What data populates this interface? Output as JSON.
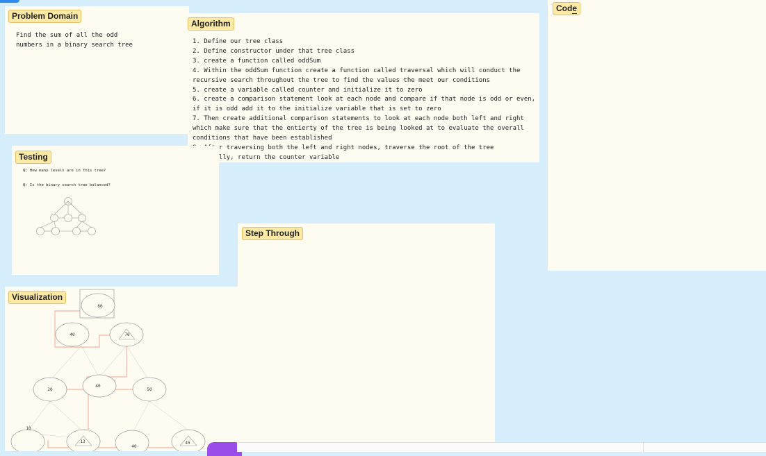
{
  "panels": {
    "problem_domain": {
      "title": "Problem Domain",
      "text": "Find the sum of all the odd\nnumbers in a binary search tree"
    },
    "algorithm": {
      "title": "Algorithm",
      "steps": [
        "1. Define our tree class",
        "2.  Define constructor under that tree class",
        "3. create a function called oddSum",
        "4. Within the oddSum function create a function called traversal which will conduct the recursive search throughout the tree to find the values the meet our conditions",
        "5. create a variable called counter and initialize it to zero",
        "6. create a comparison statement look at each node and compare if that node is odd or even, if it is odd add it to the initialize variable that is set to zero",
        "7. Then create additional comparison statements to look at each node both left and right which make sure that the entierty of the tree is being looked at to evaluate the overall conditions that have been established",
        "8. After traversing both the left and right nodes, traverse the root of the tree",
        "9. Finally, return the counter variable"
      ]
    },
    "code": {
      "title": "Code"
    },
    "testing": {
      "title": "Testing",
      "questions": [
        "Q: How many levels are in this tree?",
        "Q: Is the binary search tree balanced?"
      ]
    },
    "step_through": {
      "title": "Step Through"
    },
    "visualization": {
      "title": "Visualization",
      "nodes": [
        "60",
        "40",
        "70",
        "20",
        "40",
        "50",
        "10",
        "13",
        "40",
        "45"
      ]
    }
  },
  "colors": {
    "canvas": "#d6eefc",
    "panel": "#fefcf0",
    "label_bg": "#fde9a6",
    "highlight_path": "#f0a090",
    "node_stroke": "#999999"
  }
}
